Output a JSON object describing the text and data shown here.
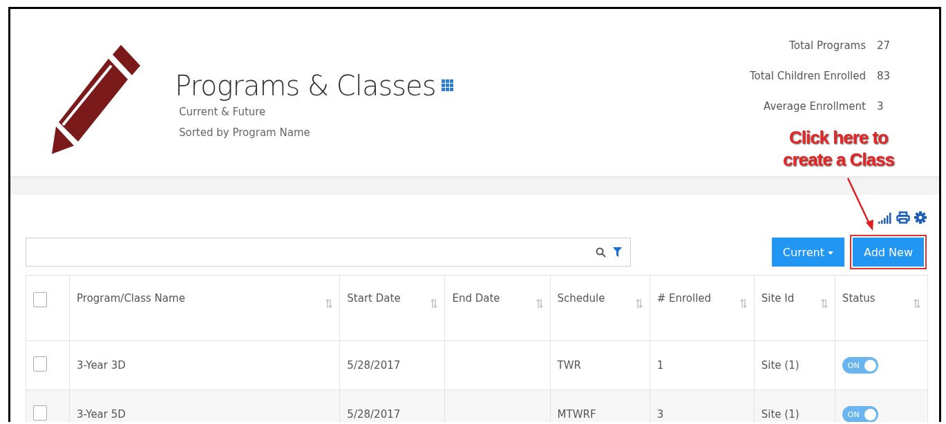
{
  "header": {
    "title": "Programs & Classes",
    "subtitles": [
      "Current & Future",
      "Sorted by Program Name"
    ]
  },
  "stats": [
    {
      "label": "Total Programs",
      "value": "27"
    },
    {
      "label": "Total Children Enrolled",
      "value": "83"
    },
    {
      "label": "Average Enrollment",
      "value": "3"
    }
  ],
  "annotation": {
    "lines": [
      "Click here to",
      "create a Class"
    ]
  },
  "toolbar": {
    "filter_button": "Current",
    "add_button": "Add New",
    "add_highlighted": true
  },
  "table": {
    "select_all_checked": false,
    "columns": [
      "Program/Class Name",
      "Start Date",
      "End Date",
      "Schedule",
      "# Enrolled",
      "Site Id",
      "Status"
    ],
    "rows": [
      {
        "checked": false,
        "name": "3-Year 3D",
        "start": "5/28/2017",
        "schedule": "TWR",
        "enrolled": "1",
        "site": "Site (1)",
        "status_label": "ON",
        "on": true
      },
      {
        "checked": false,
        "name": "3-Year 5D",
        "start": "5/28/2017",
        "schedule": "MTWRF",
        "enrolled": "3",
        "site": "Site (1)",
        "status_label": "ON",
        "on": true
      }
    ]
  }
}
